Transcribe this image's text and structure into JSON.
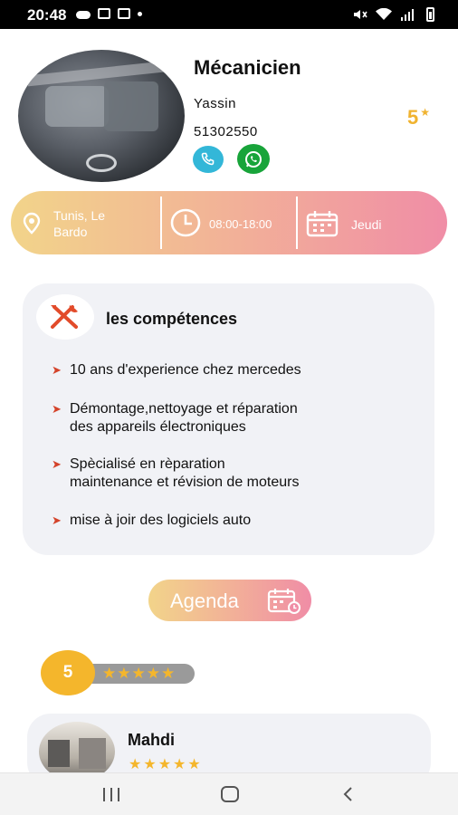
{
  "status_bar": {
    "time": "20:48"
  },
  "profile": {
    "title": "Mécanicien",
    "name": "Yassin",
    "phone": "51302550",
    "rating": "5",
    "rating_star": "★"
  },
  "info_bar": {
    "location": "Tunis, Le\nBardo",
    "hours": "08:00-18:00",
    "day": "Jeudi"
  },
  "skills": {
    "title": "les compétences",
    "items": [
      {
        "text": "10 ans d'experience chez mercedes"
      },
      {
        "text": "Démontage,nettoyage et réparation\ndes appareils électroniques"
      },
      {
        "text": "Spècialisé en rèparation\nmaintenance et révision de moteurs"
      },
      {
        "text": "mise à joir des logiciels auto"
      }
    ],
    "bullet": "➤"
  },
  "agenda": {
    "label": "Agenda"
  },
  "rating_summary": {
    "value": "5",
    "stars": "★★★★★"
  },
  "reviews": [
    {
      "name": "Mahdi",
      "stars": "★★★★★"
    }
  ],
  "colors": {
    "gradient_start": "#f2d48a",
    "gradient_end": "#f08da6",
    "star": "#f4b62c",
    "accent_arrow": "#d4432a",
    "phone": "#33b7d8",
    "whatsapp": "#18a43a"
  },
  "icons": {
    "phone": "phone-icon",
    "whatsapp": "whatsapp-icon",
    "location": "location-pin-icon",
    "clock": "clock-icon",
    "calendar": "calendar-icon",
    "tools": "tools-icon",
    "agenda": "calendar-clock-icon"
  }
}
